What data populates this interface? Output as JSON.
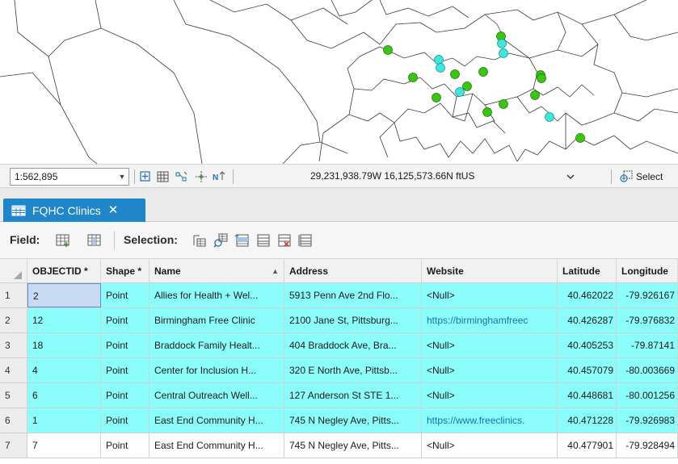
{
  "status_bar": {
    "scale": "1:562,895",
    "coordinates": "29,231,938.79W 16,125,573.66N ftUS",
    "select_label": "Select"
  },
  "icons": {
    "scale_dropdown": "chevron-down-icon",
    "coordinate_dropdown": "chevron-down-icon",
    "tab": "table-icon",
    "tab_close": "close-icon"
  },
  "tab": {
    "label": "FQHC Clinics",
    "close": "✕"
  },
  "toolbar": {
    "field_label": "Field:",
    "selection_label": "Selection:"
  },
  "colors": {
    "tab_active": "#1f86c9",
    "selected_row": "#8bfdfb",
    "point_green": "#35c80e",
    "point_cyan": "#3ee6dd",
    "link": "#1a6fb5"
  },
  "table": {
    "columns": [
      "OBJECTID *",
      "Shape *",
      "Name",
      "Address",
      "Website",
      "Latitude",
      "Longitude"
    ],
    "sort_indicator": "▲",
    "rows": [
      {
        "n": "1",
        "objectid": "2",
        "shape": "Point",
        "name": "Allies for Health + Wel...",
        "address": "5913 Penn Ave 2nd Flo...",
        "website": "<Null>",
        "lat": "40.462022",
        "lon": "-79.926167",
        "selected": true
      },
      {
        "n": "2",
        "objectid": "12",
        "shape": "Point",
        "name": "Birmingham Free Clinic",
        "address": "2100 Jane St, Pittsburg...",
        "website": "https://birminghamfreec",
        "lat": "40.426287",
        "lon": "-79.976832",
        "selected": true
      },
      {
        "n": "3",
        "objectid": "18",
        "shape": "Point",
        "name": "Braddock Family Healt...",
        "address": "404 Braddock Ave, Bra...",
        "website": "<Null>",
        "lat": "40.405253",
        "lon": "-79.87141",
        "selected": true
      },
      {
        "n": "4",
        "objectid": "4",
        "shape": "Point",
        "name": "Center for Inclusion H...",
        "address": "320 E North Ave, Pittsb...",
        "website": "<Null>",
        "lat": "40.457079",
        "lon": "-80.003669",
        "selected": true
      },
      {
        "n": "5",
        "objectid": "6",
        "shape": "Point",
        "name": "Central Outreach Well...",
        "address": "127 Anderson St STE 1...",
        "website": "<Null>",
        "lat": "40.448681",
        "lon": "-80.001256",
        "selected": true
      },
      {
        "n": "6",
        "objectid": "1",
        "shape": "Point",
        "name": "East End Community H...",
        "address": "745 N Negley Ave, Pitts...",
        "website": "https://www.freeclinics.",
        "lat": "40.471228",
        "lon": "-79.926983",
        "selected": true
      },
      {
        "n": "7",
        "objectid": "7",
        "shape": "Point",
        "name": "East End Community H...",
        "address": "745 N Negley Ave, Pitts...",
        "website": "<Null>",
        "lat": "40.477901",
        "lon": "-79.928494",
        "selected": false
      }
    ]
  }
}
